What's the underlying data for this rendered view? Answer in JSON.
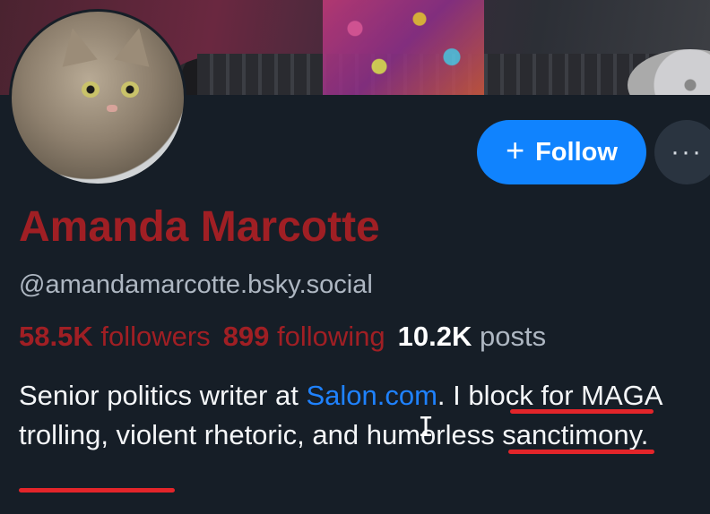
{
  "profile": {
    "display_name": "Amanda Marcotte",
    "handle": "@amandamarcotte.bsky.social",
    "avatar_icon": "cat-photo-avatar"
  },
  "actions": {
    "follow_label": "Follow",
    "follow_icon": "plus-icon",
    "more_label": "···",
    "more_icon": "ellipsis-icon"
  },
  "stats": {
    "followers_count": "58.5K",
    "followers_label": "followers",
    "following_count": "899",
    "following_label": "following",
    "posts_count": "10.2K",
    "posts_label": "posts"
  },
  "bio": {
    "part1": "Senior politics writer at ",
    "link": "Salon.com",
    "part2": ". I block for MAGA trolling, violent rhetoric, and humorless sanctimony."
  },
  "colors": {
    "background": "#161e27",
    "accent_blue": "#1083fe",
    "name_red": "#a01f24",
    "underline_red": "#e3252a"
  }
}
